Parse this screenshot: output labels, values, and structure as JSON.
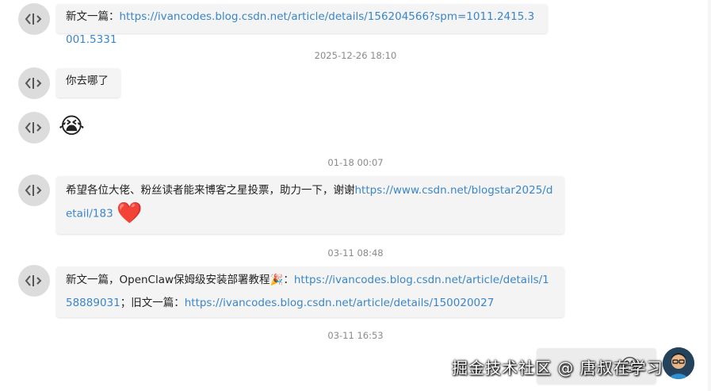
{
  "messages": [
    {
      "text": "新文一篇：",
      "link": "https://ivancodes.blog.csdn.net/article/details/156204566?spm=1011.2415.3001.5331"
    },
    {
      "time": "2025-12-26 18:10",
      "text": "你去哪了"
    },
    {
      "emoji": "😭"
    },
    {
      "time": "01-18 00:07",
      "text": "希望各位大佬、粉丝读者能来博客之星投票，助力一下，谢谢",
      "link": "https://www.csdn.net/blogstar2025/detail/183",
      "heart": "❤️"
    },
    {
      "time": "03-11 08:48",
      "text_before": "新文一篇，OpenClaw保姆级安装部署教程",
      "party": "🎉",
      "colon": "：",
      "link1": "https://ivancodes.blog.csdn.net/article/details/158889031",
      "mid": "；旧文一篇：",
      "link2": "https://ivancodes.blog.csdn.net/article/details/150020027"
    },
    {
      "time": "03-11 16:53",
      "self_emoji": "😅"
    }
  ],
  "watermark": "掘金技术社区 @ 唐叔在学习",
  "colors": {
    "link": "#3a86c8",
    "bubble": "#f4f4f4",
    "timestamp": "#8a8a8a"
  },
  "icons": {
    "contact_avatar": "code-brackets-avatar-icon",
    "self_avatar": "user-avatar-icon"
  }
}
